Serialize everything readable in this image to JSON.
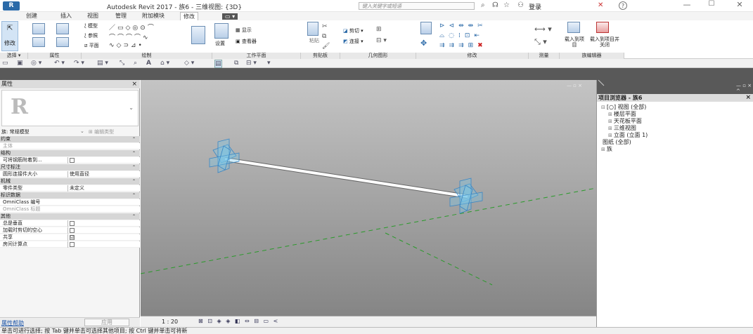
{
  "titlebar": {
    "logo": "R",
    "title": "Autodesk Revit 2017 -     族6 - 三维视图: {3D}",
    "search_placeholder": "键入关键字或短语",
    "login": "登录",
    "help": "?"
  },
  "tabs": [
    {
      "label": "创建"
    },
    {
      "label": "插入"
    },
    {
      "label": "视图"
    },
    {
      "label": "管理"
    },
    {
      "label": "附加模块"
    },
    {
      "label": "修改"
    }
  ],
  "ribbon": {
    "modify_label": "修改",
    "select_label": "选择",
    "panels": [
      {
        "label": "选择 ▾"
      },
      {
        "label": "属性"
      },
      {
        "label": "绘制"
      },
      {
        "label": "工作平面"
      },
      {
        "label": "剪贴板"
      },
      {
        "label": "几何图形"
      },
      {
        "label": "修改"
      },
      {
        "label": "测量"
      },
      {
        "label": "族编辑器"
      }
    ],
    "draw_items": [
      "模型",
      "参照",
      "平面"
    ],
    "workplane_items": [
      "设置",
      "显示",
      "查看器"
    ],
    "clipboard_items": [
      "粘贴"
    ],
    "geometry_items": [
      "剪切",
      "连接"
    ],
    "load_items": [
      "载入到项目",
      "载入到项目并关闭"
    ]
  },
  "properties": {
    "title": "属性",
    "close": "×",
    "family_label": "族: 常规模型",
    "edit_type": "编辑类型",
    "rows": [
      {
        "kind": "group",
        "label": "约束"
      },
      {
        "kind": "item",
        "label": "主体",
        "value": "",
        "disabled": true
      },
      {
        "kind": "group",
        "label": "结构"
      },
      {
        "kind": "item",
        "label": "可将钢筋附着到...",
        "value": "",
        "check": ""
      },
      {
        "kind": "group",
        "label": "尺寸标注"
      },
      {
        "kind": "item",
        "label": "圆形连接件大小",
        "value": "使用直径"
      },
      {
        "kind": "group",
        "label": "机械"
      },
      {
        "kind": "item",
        "label": "零件类型",
        "value": "未定义"
      },
      {
        "kind": "group",
        "label": "标识数据"
      },
      {
        "kind": "item",
        "label": "OmniClass 编号",
        "value": ""
      },
      {
        "kind": "item",
        "label": "OmniClass 标题",
        "value": "",
        "disabled": true
      },
      {
        "kind": "group",
        "label": "其他"
      },
      {
        "kind": "item",
        "label": "总是垂直",
        "value": "",
        "check": ""
      },
      {
        "kind": "item",
        "label": "加载时剪切的空心",
        "value": "",
        "check": ""
      },
      {
        "kind": "item",
        "label": "共享",
        "value": "",
        "check": "☑"
      },
      {
        "kind": "item",
        "label": "房间计算点",
        "value": "",
        "check": ""
      }
    ],
    "help_link": "属性帮助",
    "apply": "应用"
  },
  "view": {
    "scale": "1 : 20",
    "nav_icons": "⊠ ⊡ ◈ ◈ ◧ ⇔ ⊟ ▭ <"
  },
  "browser": {
    "title": "项目浏览器 - 族6",
    "close": "×",
    "tree": [
      {
        "toggle": "⊟",
        "label": "[○] 视图 (全部)",
        "indent": 0
      },
      {
        "toggle": "⊞",
        "label": "楼层平面",
        "indent": 1
      },
      {
        "toggle": "⊞",
        "label": "天花板平面",
        "indent": 1
      },
      {
        "toggle": "⊞",
        "label": "三维视图",
        "indent": 1
      },
      {
        "toggle": "⊞",
        "label": "立面 (立面 1)",
        "indent": 1
      },
      {
        "toggle": "",
        "label": "图纸 (全部)",
        "indent": 0
      },
      {
        "toggle": "⊞",
        "label": "族",
        "indent": 0
      }
    ]
  },
  "status": {
    "text": "单击可进行选择; 按 Tab 键并单击可选择其他项目; 按 Ctrl 键并单击可将新"
  }
}
